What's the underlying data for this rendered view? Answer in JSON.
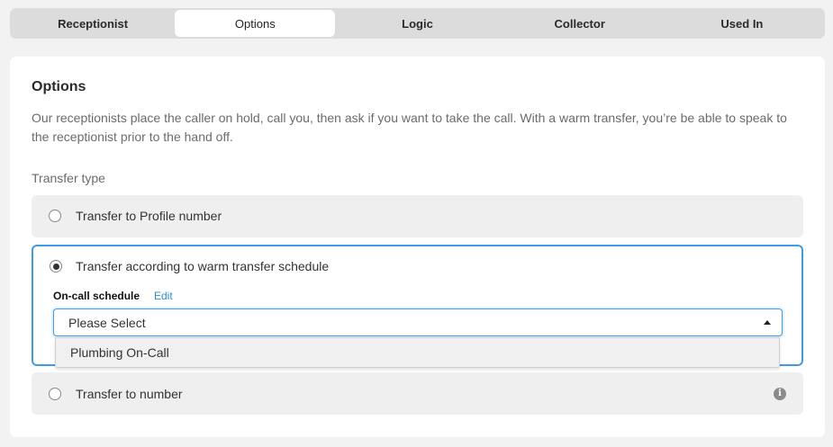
{
  "tabs": [
    {
      "label": "Receptionist"
    },
    {
      "label": "Options",
      "active": true
    },
    {
      "label": "Logic"
    },
    {
      "label": "Collector"
    },
    {
      "label": "Used In"
    }
  ],
  "options_panel": {
    "title": "Options",
    "description": "Our receptionists place the caller on hold, call you, then ask if you want to take the call. With a warm transfer, you’re be able to speak to the receptionist prior to the hand off.",
    "transfer_type_label": "Transfer type",
    "transfer_options": [
      {
        "label": "Transfer to Profile number",
        "selected": false
      },
      {
        "label": "Transfer according to warm transfer schedule",
        "selected": true
      },
      {
        "label": "Transfer to number",
        "selected": false
      }
    ],
    "schedule": {
      "label": "On-call schedule",
      "edit_label": "Edit",
      "select_value": "Please Select",
      "dropdown_options": [
        "Plumbing On-Call"
      ]
    }
  },
  "colors": {
    "accent": "#3d9be9",
    "link": "#2a8fd8",
    "tab_bar_bg": "#dcdcdc",
    "page_bg": "#f2f2f2"
  }
}
